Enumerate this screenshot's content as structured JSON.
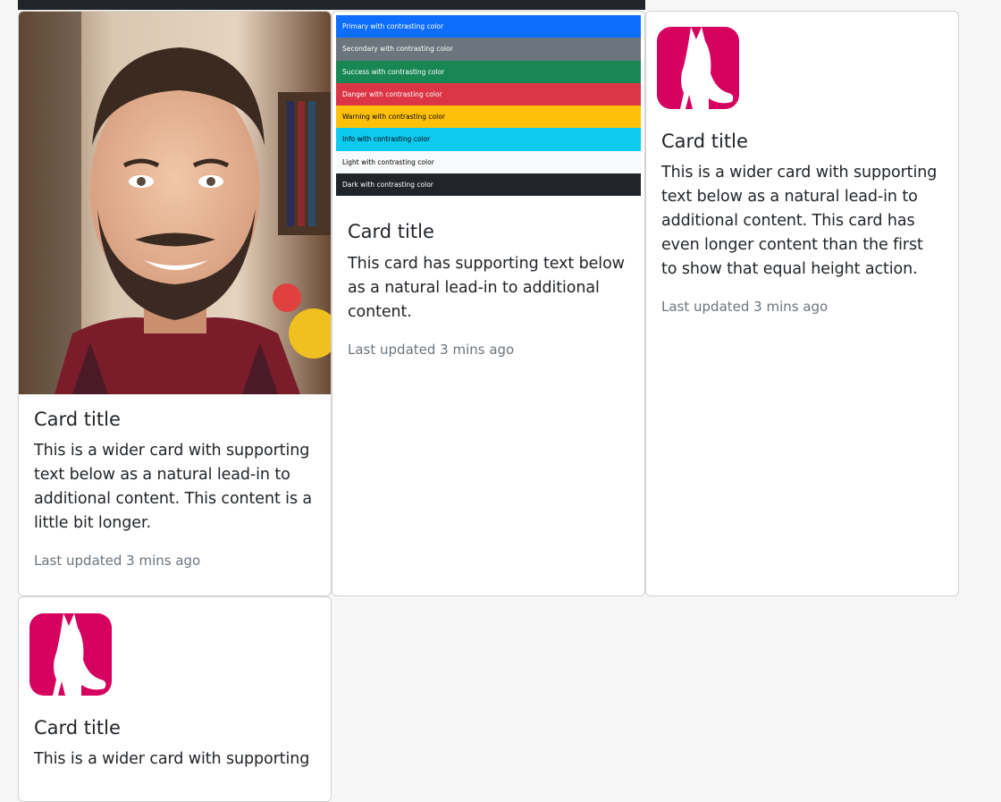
{
  "cards": [
    {
      "title": "Card title",
      "text": "This is a wider card with supporting text below as a natural lead-in to additional content. This content is a little bit longer.",
      "updated": "Last updated 3 mins ago",
      "image": "portrait-photo"
    },
    {
      "title": "Card title",
      "text": "This card has supporting text below as a natural lead-in to additional content.",
      "updated": "Last updated 3 mins ago",
      "image": "color-swatches",
      "swatches": [
        {
          "label": "Primary with contrasting color",
          "bg": "#0d6efd",
          "fg": "#ffffff"
        },
        {
          "label": "Secondary with contrasting color",
          "bg": "#6c757d",
          "fg": "#ffffff"
        },
        {
          "label": "Success with contrasting color",
          "bg": "#198754",
          "fg": "#ffffff"
        },
        {
          "label": "Danger with contrasting color",
          "bg": "#dc3545",
          "fg": "#ffffff"
        },
        {
          "label": "Warning with contrasting color",
          "bg": "#ffc107",
          "fg": "#000000"
        },
        {
          "label": "Info with contrasting color",
          "bg": "#0dcaf0",
          "fg": "#000000"
        },
        {
          "label": "Light with contrasting color",
          "bg": "#f8f9fa",
          "fg": "#000000"
        },
        {
          "label": "Dark with contrasting color",
          "bg": "#212529",
          "fg": "#ffffff"
        }
      ]
    },
    {
      "title": "Card title",
      "text": "This is a wider card with supporting text below as a natural lead-in to additional content. This card has even longer content than the first to show that equal height action.",
      "updated": "Last updated 3 mins ago",
      "image": "cat-logo-icon"
    },
    {
      "title": "Card title",
      "text": "This is a wider card with supporting",
      "image": "cat-logo-icon"
    }
  ],
  "colors": {
    "logo": "#d6005f",
    "muted": "#6c757d"
  }
}
